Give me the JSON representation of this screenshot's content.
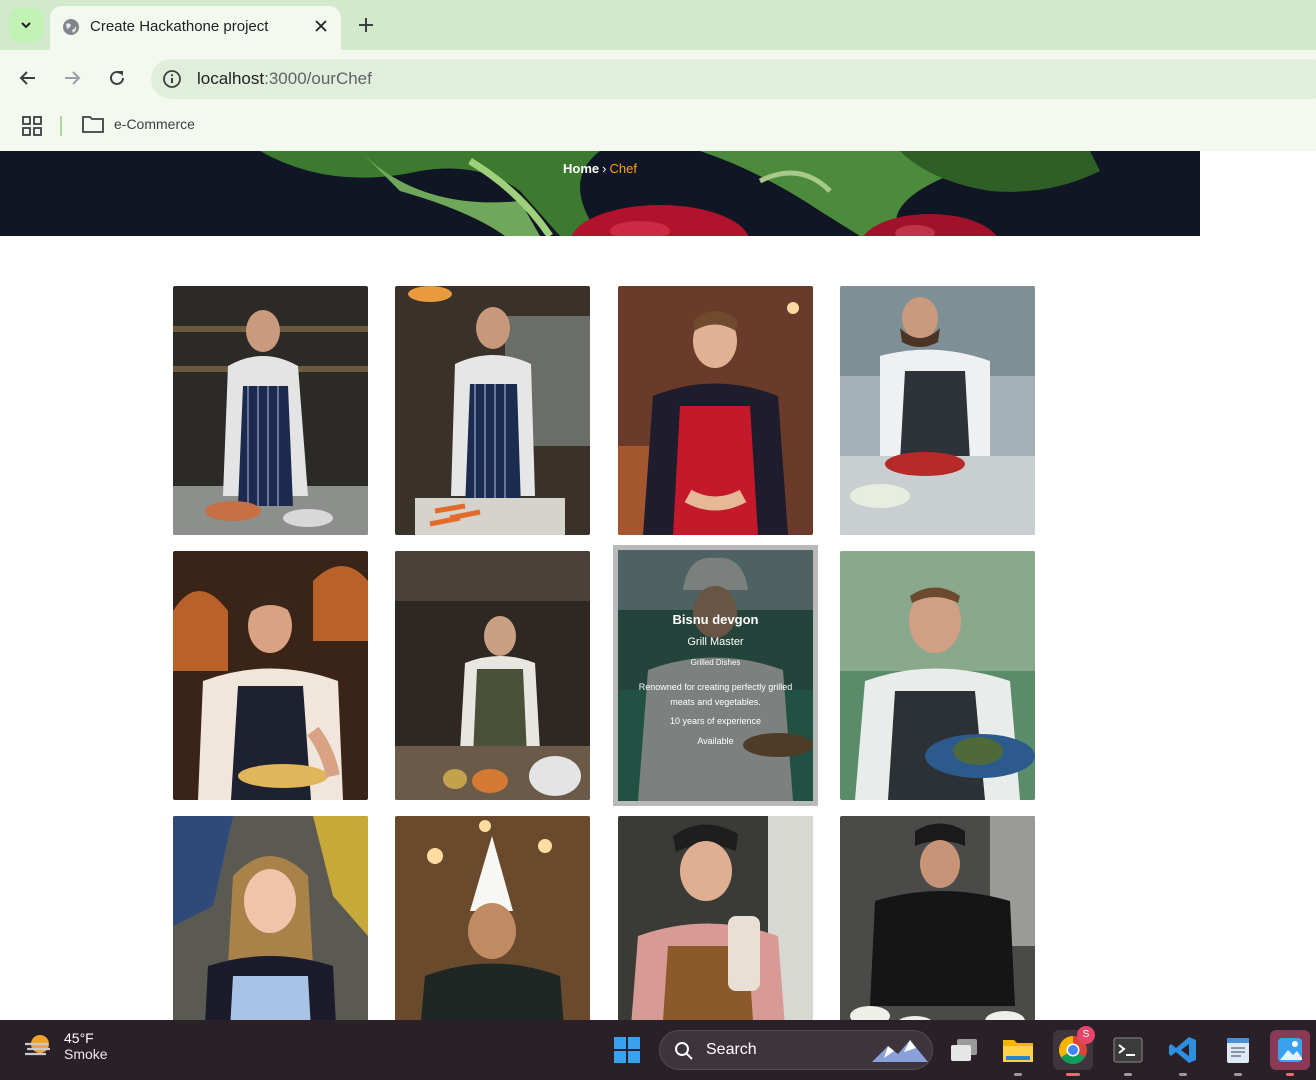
{
  "browser": {
    "tab_title": "Create Hackathone project",
    "url_host": "localhost",
    "url_path": ":3000/ourChef",
    "bookmark_folder": "e-Commerce"
  },
  "hero": {
    "breadcrumb_home": "Home",
    "breadcrumb_separator": "›",
    "breadcrumb_current": "Chef"
  },
  "chefs": [
    {
      "image": "chef-chopping-vegetables"
    },
    {
      "image": "chef-cutting-carrots"
    },
    {
      "image": "smiling-chef-red-apron"
    },
    {
      "image": "chef-preparing-meat"
    },
    {
      "image": "chef-plating-under-heat-lamps"
    },
    {
      "image": "chef-working-at-counter"
    },
    {
      "image": "chef-in-toque-holding-plate"
    },
    {
      "image": "chef-holding-dish"
    },
    {
      "image": "smiling-woman-chef"
    },
    {
      "image": "chef-with-tall-hat"
    },
    {
      "image": "laughing-chef-with-milkshake"
    },
    {
      "image": "chef-plating-many-dishes"
    }
  ],
  "featured_chef": {
    "name": "Bisnu devgon",
    "role": "Grill Master",
    "specialty": "Grilled Dishes",
    "description": "Renowned for creating perfectly grilled meats and vegetables.",
    "experience": "10 years of experience",
    "availability": "Available"
  },
  "taskbar": {
    "temperature": "45°F",
    "condition": "Smoke",
    "search_label": "Search",
    "chrome_badge": "S"
  },
  "colors": {
    "accent": "#ff9f0d",
    "tabbar": "#d3e9cc",
    "toolbar": "#f3f9ef",
    "hero_bg": "#111726",
    "taskbar": "#2a2128"
  }
}
